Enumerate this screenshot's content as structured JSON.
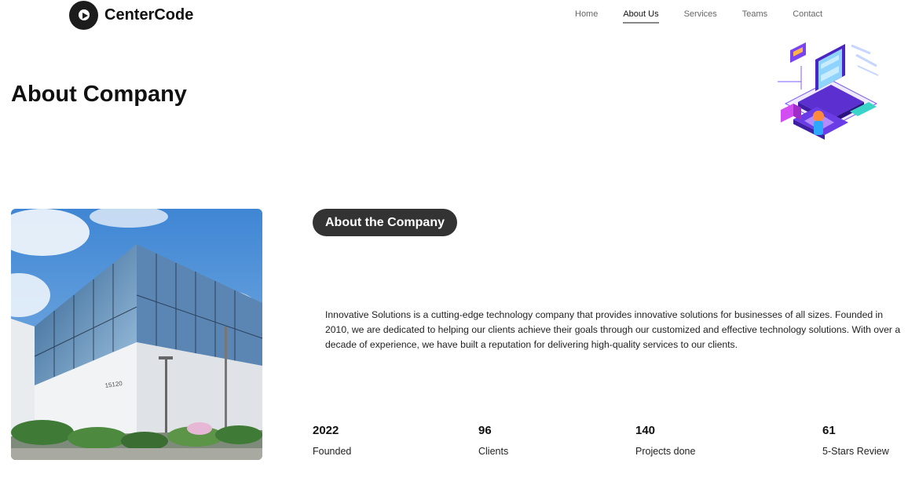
{
  "brand": {
    "name": "CenterCode"
  },
  "nav": {
    "items": [
      {
        "label": "Home",
        "active": false
      },
      {
        "label": "About Us",
        "active": true
      },
      {
        "label": "Services",
        "active": false
      },
      {
        "label": "Teams",
        "active": false
      },
      {
        "label": "Contact",
        "active": false
      }
    ]
  },
  "hero": {
    "title": "About Company"
  },
  "section": {
    "badge": "About the Company",
    "description": "Innovative Solutions is a cutting-edge technology company that provides innovative solutions for businesses of all sizes. Founded in 2010, we are dedicated to helping our clients achieve their goals through our customized and effective technology solutions. With over a decade of experience, we have built a reputation for delivering high-quality services to our clients."
  },
  "stats": [
    {
      "value": "2022",
      "label": "Founded"
    },
    {
      "value": "96",
      "label": "Clients"
    },
    {
      "value": "140",
      "label": "Projects done"
    },
    {
      "value": "61",
      "label": "5-Stars Review"
    }
  ],
  "colors": {
    "badge_bg": "#333333",
    "accent_purple": "#6b3fd6"
  }
}
